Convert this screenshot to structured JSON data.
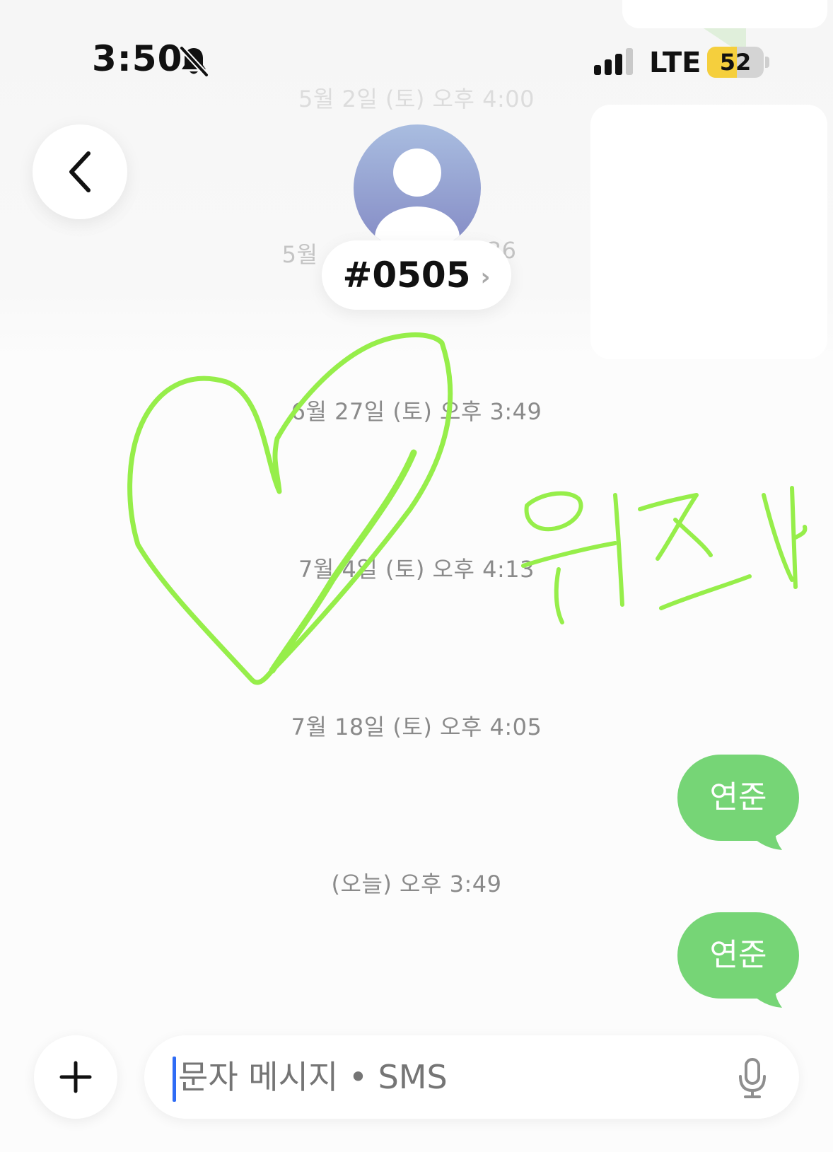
{
  "status_bar": {
    "time": "3:50",
    "network": "LTE",
    "battery_level": "52",
    "battery_fraction": 0.52,
    "icons": [
      "bell-slash-icon",
      "signal-bars-icon"
    ]
  },
  "header": {
    "contact_name": "#0505",
    "contact_chevron": "›",
    "icons": [
      "back-chevron-icon",
      "person-avatar-icon"
    ]
  },
  "messages": {
    "timestamps": {
      "t1": "5월 2일 (토) 오후 4:00",
      "t2_left": "5월",
      "t2_right": ":36",
      "t3": "6월 27일 (토) 오후 3:49",
      "t4": "7월 4일 (토) 오후 4:13",
      "t5": "7월 18일 (토) 오후 4:05",
      "t6": "(오늘) 오후 3:49"
    },
    "bubbles": [
      "연준",
      "연준"
    ],
    "bubble_color": "#76d576"
  },
  "doodle": {
    "color": "#96ee4a",
    "handwriting_text": "위즈나"
  },
  "composer": {
    "placeholder": "문자 메시지 • SMS",
    "icons": [
      "plus-icon",
      "microphone-icon"
    ]
  }
}
